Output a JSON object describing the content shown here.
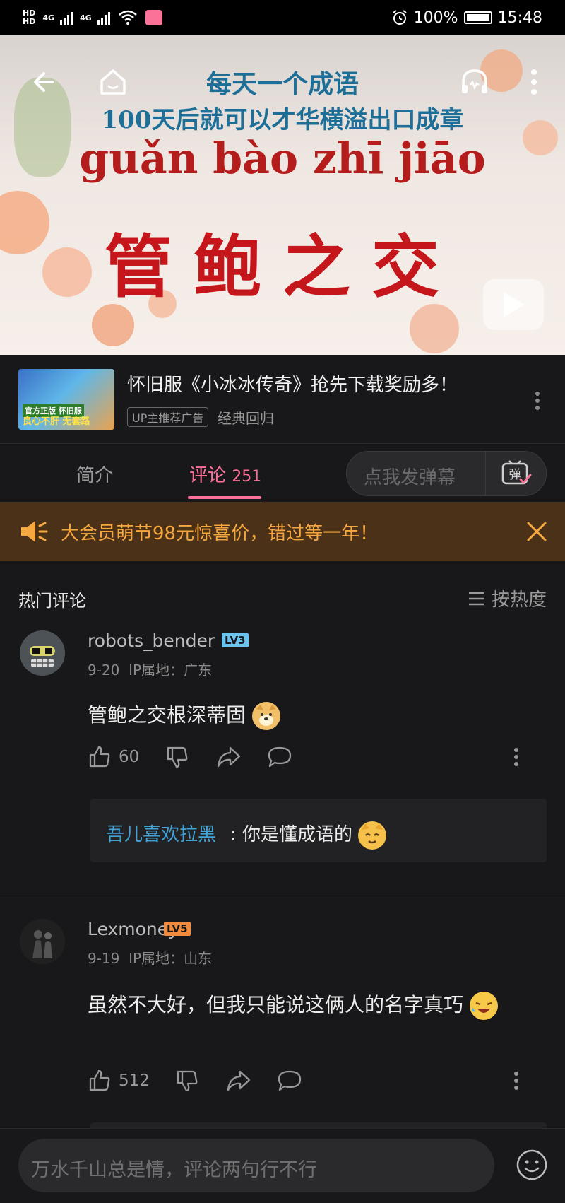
{
  "status_bar": {
    "hd1": "HD",
    "hd2": "HD",
    "net1": "4G",
    "net2": "4G",
    "battery": "100%",
    "time": "15:48"
  },
  "video": {
    "line1": "每天一个成语",
    "line2": "100天后就可以才华横溢出口成章",
    "pinyin": "guǎn bào zhī jiāo",
    "idiom": "管鲍之交"
  },
  "ad": {
    "title": "怀旧服《小冰冰传奇》抢先下载奖励多！",
    "tag": "UP主推荐广告",
    "subtitle": "经典回归",
    "thumb_text1": "官方正版 怀旧服",
    "thumb_text2": "良心不肝 无套路"
  },
  "tabs": {
    "intro": "简介",
    "comments_label": "评论",
    "comments_count": "251",
    "danmaku_placeholder": "点我发弹幕",
    "danmaku_icon_text": "弹"
  },
  "promo": {
    "text": "大会员萌节98元惊喜价，错过等一年！"
  },
  "comments_header": {
    "title": "热门评论",
    "sort": "按热度"
  },
  "comments": [
    {
      "username": "robots_bender",
      "level": "LV3",
      "date": "9-20",
      "ip": "IP属地：广东",
      "text": "管鲍之交根深蒂固",
      "likes": "60",
      "reply": {
        "name": "吾儿喜欢拉黑",
        "text": ": 你是懂成语的"
      }
    },
    {
      "username": "Lexmoney",
      "level": "LV5",
      "date": "9-19",
      "ip": "IP属地：山东",
      "text": "虽然不大好，但我只能说这俩人的名字真巧",
      "likes": "512"
    }
  ],
  "bottom": {
    "placeholder": "万水千山总是情，评论两句行不行"
  },
  "colors": {
    "accent": "#fb7299",
    "promo_bg": "#4a3117",
    "promo_text": "#f7a73f",
    "reply_name": "#3fa3d9",
    "lv3": "#6bc4f0",
    "lv5": "#f28b3d"
  }
}
